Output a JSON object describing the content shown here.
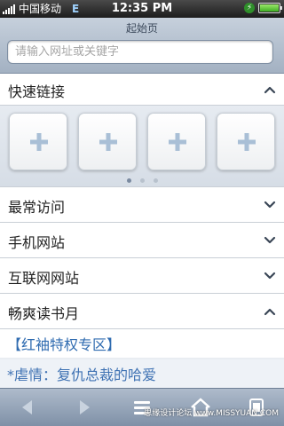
{
  "status_bar": {
    "carrier": "中国移动",
    "network": "E",
    "time": "12:35 PM"
  },
  "header": {
    "title": "起始页",
    "search_placeholder": "请输入网址或关键字"
  },
  "sections": {
    "quick_links": "快速链接",
    "frequent": "最常访问",
    "mobile_sites": "手机网站",
    "internet_sites": "互联网网站",
    "reading_month": "畅爽读书月"
  },
  "quick_tiles": [
    "+",
    "+",
    "+",
    "+"
  ],
  "page_dots": {
    "count": 3,
    "active_index": 0
  },
  "reading_items": [
    "【红袖特权专区】",
    "*虐情：复仇总裁的哈爱"
  ],
  "watermark": "思缘设计论坛 www.MISSYUAN.COM",
  "colors": {
    "link_blue": "#2f6bb0",
    "toolbar_top": "#aebbcb",
    "header_top": "#c6d0dc"
  },
  "icons": {
    "toolbar": [
      "back-arrow-icon",
      "forward-arrow-icon",
      "menu-icon",
      "home-icon",
      "pages-icon"
    ]
  }
}
